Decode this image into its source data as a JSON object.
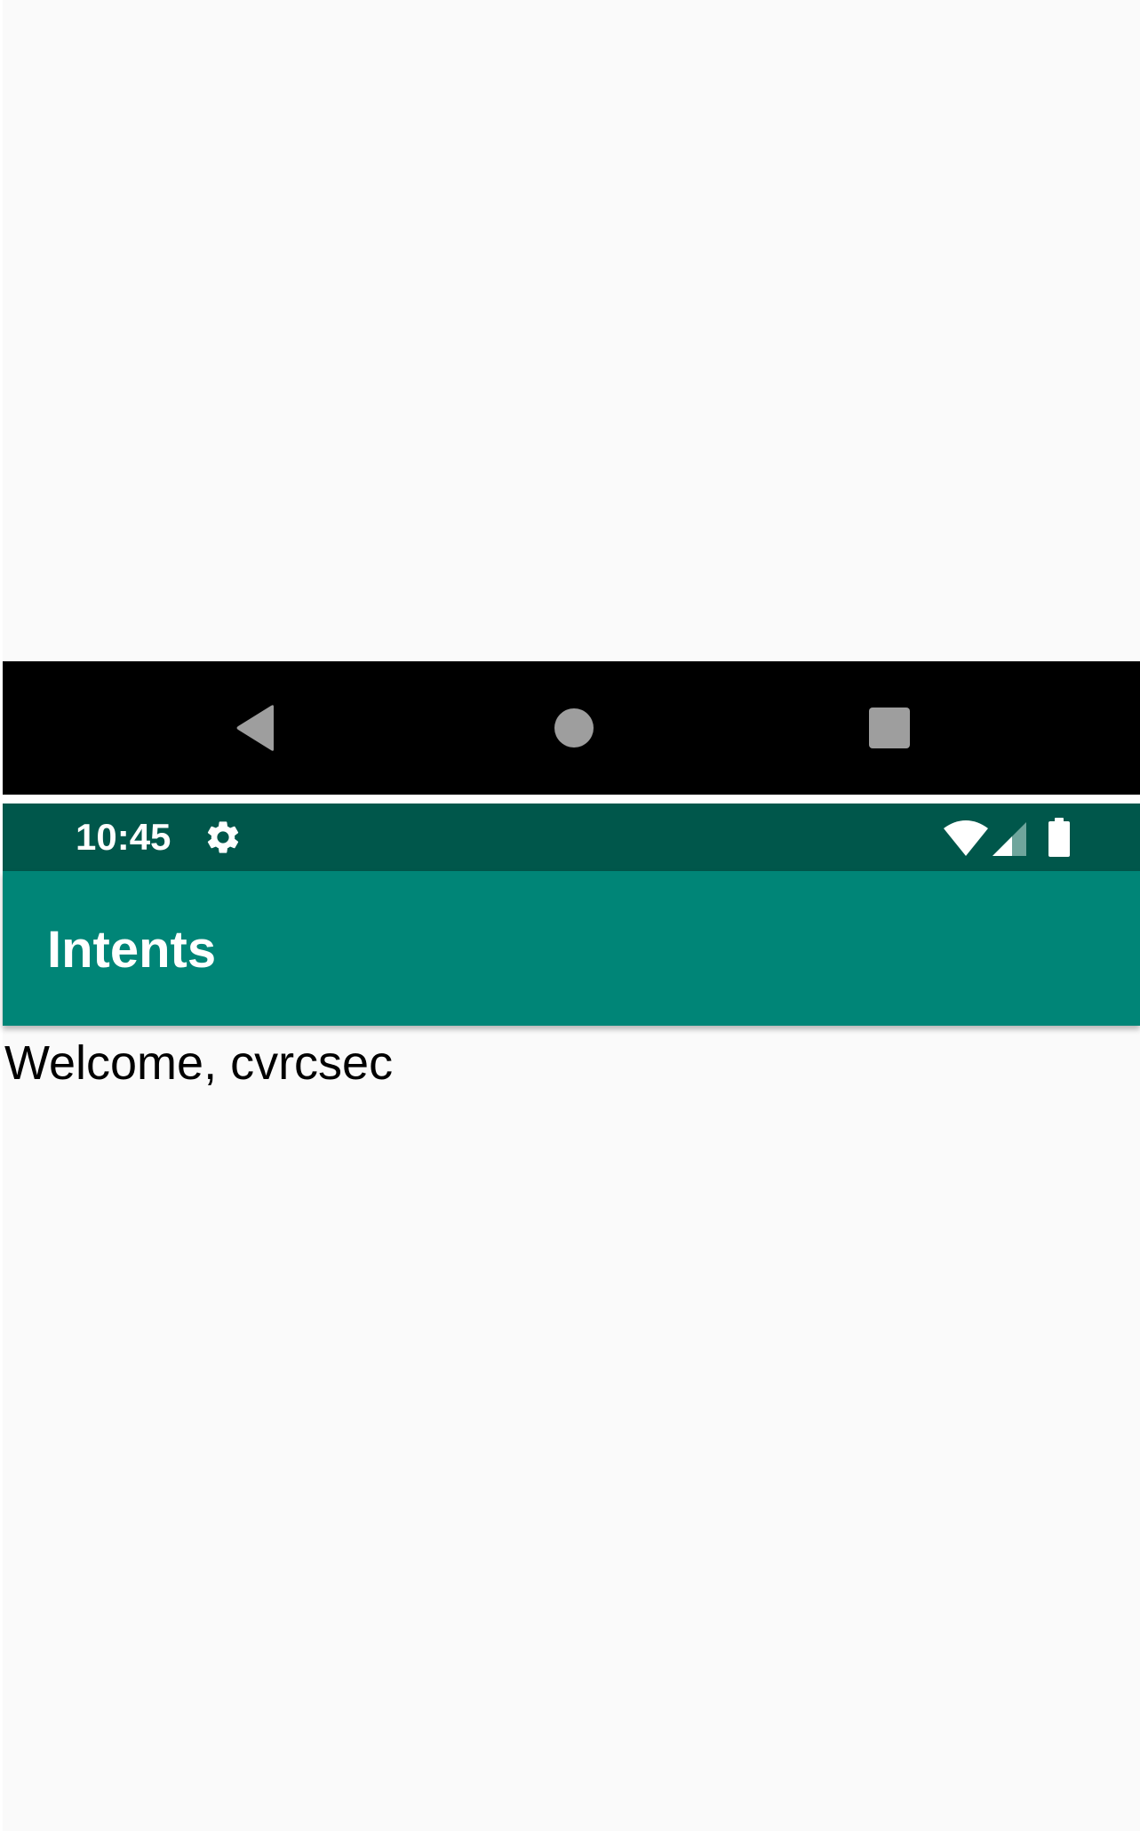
{
  "navigation_bar": {
    "back_icon": "back-triangle-icon",
    "home_icon": "home-circle-icon",
    "recents_icon": "recents-square-icon",
    "icon_color": "#9e9e9e",
    "background": "#000000"
  },
  "status_bar": {
    "time": "10:45",
    "settings_icon": "gear-icon",
    "wifi_icon": "wifi-icon",
    "signal_icon": "cell-signal-icon",
    "battery_icon": "battery-icon",
    "background": "#00574b"
  },
  "app_bar": {
    "title": "Intents",
    "background": "#008577"
  },
  "main": {
    "welcome_text": "Welcome, cvrcsec"
  }
}
